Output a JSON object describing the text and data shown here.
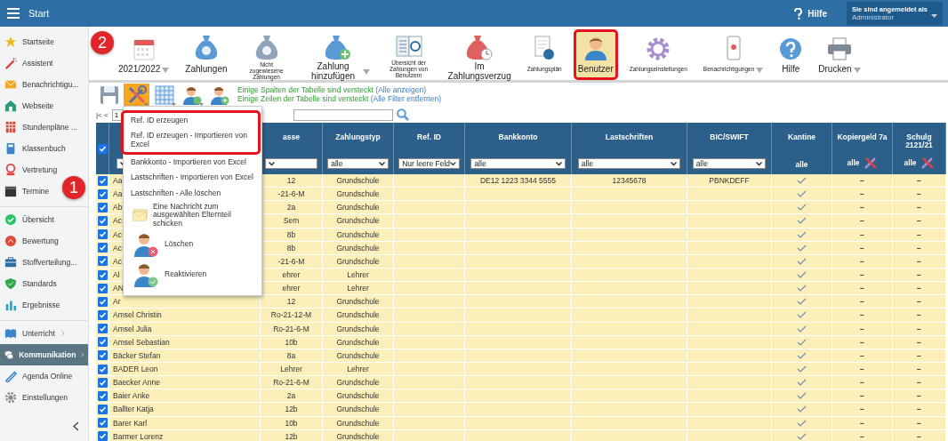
{
  "top_bar": {
    "title": "Start",
    "help": "Hilfe",
    "user_caption": "Sie sind angemeldet als",
    "user_name": "Administrator"
  },
  "sidebar": {
    "groups": [
      [
        {
          "label": "Startseite",
          "selected": false
        },
        {
          "label": "Assistent",
          "selected": false
        },
        {
          "label": "Benachrichtigu...",
          "selected": false
        },
        {
          "label": "Webseite",
          "selected": false
        },
        {
          "label": "Stundenpläne ...",
          "selected": false
        },
        {
          "label": "Klassenbuch",
          "selected": false
        },
        {
          "label": "Vertretung",
          "selected": false
        },
        {
          "label": "Termine",
          "selected": false
        }
      ],
      [
        {
          "label": "Übersicht",
          "selected": false
        },
        {
          "label": "Bewertung",
          "selected": false
        },
        {
          "label": "Stoffverteilung...",
          "selected": false
        },
        {
          "label": "Standards",
          "selected": false
        },
        {
          "label": "Ergebnisse",
          "selected": false
        }
      ],
      [
        {
          "label": "Unterricht",
          "selected": false,
          "submenu": true
        },
        {
          "label": "Kommunikation",
          "selected": true,
          "submenu": true
        },
        {
          "label": "Agenda Online",
          "selected": false,
          "submenu": false
        },
        {
          "label": "Einstellungen",
          "selected": false,
          "submenu": false
        }
      ]
    ]
  },
  "toolbar": {
    "items": [
      {
        "label": "2021/2022",
        "kind": "normal",
        "caret": true,
        "selected": false,
        "highlighted": false
      },
      {
        "label": "Zahlungen",
        "kind": "normal",
        "caret": false,
        "selected": false,
        "highlighted": false
      },
      {
        "label": "Nicht zugewiesene Zahlungen",
        "kind": "compact",
        "caret": false,
        "selected": false,
        "highlighted": false
      },
      {
        "label": "Zahlung hinzufügen",
        "kind": "normal",
        "caret": true,
        "selected": false,
        "highlighted": false
      },
      {
        "label": "Übersicht der Zahlungen von Benutzern",
        "kind": "compact",
        "caret": false,
        "selected": false,
        "highlighted": false
      },
      {
        "label": "Im Zahlungsverzug",
        "kind": "normal",
        "caret": false,
        "selected": false,
        "highlighted": false
      },
      {
        "label": "Zahlungsplän",
        "kind": "compact",
        "caret": false,
        "selected": false,
        "highlighted": false
      },
      {
        "label": "Benutzer",
        "kind": "normal",
        "caret": false,
        "selected": true,
        "highlighted": true
      },
      {
        "label": "Zahlungseinstellungen",
        "kind": "compact",
        "caret": false,
        "selected": false,
        "highlighted": false
      },
      {
        "label": "Benachrichtigungen",
        "kind": "compact",
        "caret": true,
        "selected": false,
        "highlighted": false
      },
      {
        "label": "Hilfe",
        "kind": "normal",
        "caret": false,
        "selected": false,
        "highlighted": false
      },
      {
        "label": "Drucken",
        "kind": "normal",
        "caret": true,
        "selected": false,
        "highlighted": false
      }
    ]
  },
  "actions": [
    {
      "selected": false,
      "caret": false
    },
    {
      "selected": true,
      "caret": true
    },
    {
      "selected": false,
      "caret": true
    },
    {
      "selected": false,
      "caret": true
    },
    {
      "selected": false,
      "caret": false
    }
  ],
  "notices": [
    {
      "text": "Einige Spalten der Tabelle sind versteckt",
      "link": "(Alle anzeigen)"
    },
    {
      "text": "Einige Zeilen der Tabelle sind versteckt",
      "link": "(Alle Filter entfernen)"
    }
  ],
  "pager": {
    "first_prev": "|< <",
    "page": "1"
  },
  "table": {
    "select_all": true,
    "columns": [
      {
        "kind": "select"
      },
      {
        "label": "asse",
        "kind": "select"
      },
      {
        "label": "Zahlungstyp",
        "kind": "select",
        "value": "alle"
      },
      {
        "label": "Ref. ID",
        "kind": "select",
        "value": "Nur leere Feld"
      },
      {
        "label": "Bankkonto",
        "kind": "select",
        "value": "alle"
      },
      {
        "label": "Lastschriften",
        "kind": "select",
        "value": "alle"
      },
      {
        "label": "BIC/SWIFT",
        "kind": "select",
        "value": "alle"
      },
      {
        "label": "Kantine",
        "kind": "text",
        "value": "alle",
        "tools": false
      },
      {
        "label": "Kopiergeld 7a",
        "kind": "text",
        "value": "alle",
        "tools": true
      },
      {
        "label": "Schulg 2121/21",
        "kind": "text",
        "value": "alle",
        "tools": true
      }
    ],
    "rows": [
      {
        "checked": true,
        "name": "Aa",
        "klasse": "12",
        "typ": "Grundschule",
        "bank": "DE12 1223 3344 5555",
        "last": "12345678",
        "bic": "PBNKDEFF",
        "kantine": true,
        "kopier": "−",
        "schul": "−"
      },
      {
        "checked": true,
        "name": "Aa",
        "klasse": "-21-6-M",
        "typ": "Grundschule",
        "kantine": true,
        "kopier": "−",
        "schul": "−"
      },
      {
        "checked": true,
        "name": "Ab",
        "klasse": "2a",
        "typ": "Grundschule",
        "kantine": true,
        "kopier": "−",
        "schul": "−"
      },
      {
        "checked": true,
        "name": "Ac",
        "klasse": "Sem",
        "typ": "Grundschule",
        "kantine": true,
        "kopier": "−",
        "schul": "−"
      },
      {
        "checked": true,
        "name": "Ac",
        "klasse": "8b",
        "typ": "Grundschule",
        "kantine": true,
        "kopier": "−",
        "schul": "−"
      },
      {
        "checked": true,
        "name": "Ac",
        "klasse": "8b",
        "typ": "Grundschule",
        "kantine": true,
        "kopier": "−",
        "schul": "−"
      },
      {
        "checked": true,
        "name": "Ac",
        "klasse": "-21-6-M",
        "typ": "Grundschule",
        "kantine": true,
        "kopier": "−",
        "schul": "−"
      },
      {
        "checked": true,
        "name": "Al",
        "klasse": "ehrer",
        "typ": "Lehrer",
        "kantine": true,
        "kopier": "−",
        "schul": "−"
      },
      {
        "checked": true,
        "name": "AN",
        "klasse": "ehrer",
        "typ": "Lehrer",
        "kantine": true,
        "kopier": "−",
        "schul": "−"
      },
      {
        "checked": true,
        "name": "Ar",
        "klasse": "12",
        "typ": "Grundschule",
        "kantine": true,
        "kopier": "−",
        "schul": "−"
      },
      {
        "checked": true,
        "name": "Amsel Christin",
        "klasse": "Ro-21-12-M",
        "typ": "Grundschule",
        "kantine": true,
        "kopier": "−",
        "schul": "−"
      },
      {
        "checked": true,
        "name": "Amsel Julia",
        "klasse": "Ro-21-6-M",
        "typ": "Grundschule",
        "kantine": true,
        "kopier": "−",
        "schul": "−"
      },
      {
        "checked": true,
        "name": "Amsel Sebastian",
        "klasse": "10b",
        "typ": "Grundschule",
        "kantine": true,
        "kopier": "−",
        "schul": "−"
      },
      {
        "checked": true,
        "name": "Bäcker Stefan",
        "klasse": "8a",
        "typ": "Grundschule",
        "kantine": true,
        "kopier": "−",
        "schul": "−"
      },
      {
        "checked": true,
        "name": "BADER Leon",
        "klasse": "Lehrer",
        "typ": "Lehrer",
        "kantine": true,
        "kopier": "−",
        "schul": "−"
      },
      {
        "checked": true,
        "name": "Baecker Anne",
        "klasse": "Ro-21-6-M",
        "typ": "Grundschule",
        "kantine": true,
        "kopier": "−",
        "schul": "−"
      },
      {
        "checked": true,
        "name": "Baier Anke",
        "klasse": "2a",
        "typ": "Grundschule",
        "kantine": true,
        "kopier": "−",
        "schul": "−"
      },
      {
        "checked": true,
        "name": "Ballter Katja",
        "klasse": "12b",
        "typ": "Grundschule",
        "kantine": true,
        "kopier": "−",
        "schul": "−"
      },
      {
        "checked": true,
        "name": "Barer Karl",
        "klasse": "10b",
        "typ": "Grundschule",
        "kantine": true,
        "kopier": "−",
        "schul": "−"
      },
      {
        "checked": true,
        "name": "Barmer Lorenz",
        "klasse": "12b",
        "typ": "Grundschule",
        "kantine": true,
        "kopier": "−",
        "schul": "−"
      }
    ]
  },
  "menu": {
    "items": [
      {
        "label": "Ref. ID erzeugen",
        "kind": "text",
        "highlighted": true
      },
      {
        "label": "Ref. ID erzeugen - Importieren von Excel",
        "kind": "text",
        "highlighted": true
      },
      {
        "label": "Bankkonto - Importieren von Excel",
        "kind": "text",
        "highlighted": false
      },
      {
        "label": "Lastschriften - Importieren von Excel",
        "kind": "text",
        "highlighted": false
      },
      {
        "label": "Lastschriften - Alle löschen",
        "kind": "text",
        "highlighted": false
      },
      {
        "label": "Eine Nachricht zum ausgewählten Elternteil schicken",
        "kind": "message",
        "highlighted": false
      },
      {
        "label": "Löschen",
        "kind": "delete",
        "highlighted": false
      },
      {
        "label": "Reaktivieren",
        "kind": "reactivate",
        "highlighted": false
      }
    ]
  },
  "badges": [
    "1",
    "2"
  ]
}
